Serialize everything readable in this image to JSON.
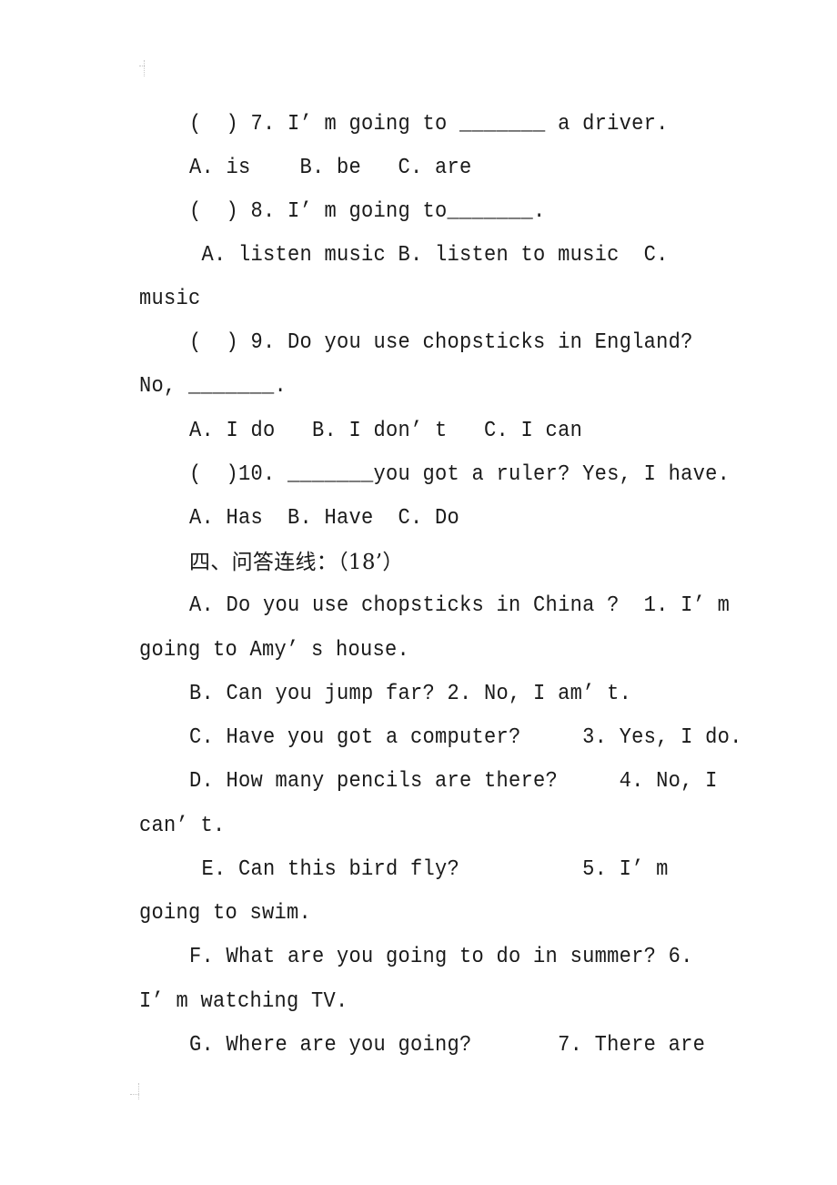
{
  "document": {
    "lines": [
      {
        "id": "q7",
        "text": "(  ) 7. I’ m going to _______ a driver."
      },
      {
        "id": "q7-options",
        "text": "A. is    B. be   C. are"
      },
      {
        "id": "q8",
        "text": "(  ) 8. I’ m going to_______."
      },
      {
        "id": "q8-options",
        "text": " A. listen music B. listen to music  C."
      },
      {
        "id": "q8-options-cont",
        "text": "music"
      },
      {
        "id": "q9",
        "text": "(  ) 9. Do you use chopsticks in England?"
      },
      {
        "id": "q9-cont",
        "text": "No, _______."
      },
      {
        "id": "q9-options",
        "text": "A. I do   B. I don’ t   C. I can"
      },
      {
        "id": "q10",
        "text": "(  )10. _______you got a ruler? Yes, I have."
      },
      {
        "id": "q10-options",
        "text": "A. Has  B. Have  C. Do"
      },
      {
        "id": "section-4-title",
        "text": "四、问答连线：（18’）"
      },
      {
        "id": "match-a",
        "text": "A. Do you use chopsticks in China ?  1. I’ m"
      },
      {
        "id": "match-a-cont",
        "text": "going to Amy’ s house."
      },
      {
        "id": "match-b",
        "text": "B. Can you jump far? 2. No, I am’ t."
      },
      {
        "id": "match-c",
        "text": "C. Have you got a computer?     3. Yes, I do."
      },
      {
        "id": "match-d",
        "text": "D. How many pencils are there?     4. No, I"
      },
      {
        "id": "match-d-cont",
        "text": "can’ t."
      },
      {
        "id": "match-e",
        "text": " E. Can this bird fly?          5. I’ m"
      },
      {
        "id": "match-e-cont",
        "text": "going to swim."
      },
      {
        "id": "match-f",
        "text": "F. What are you going to do in summer? 6."
      },
      {
        "id": "match-f-cont",
        "text": "I’ m watching TV."
      },
      {
        "id": "match-g",
        "text": "G. Where are you going?       7. There are"
      }
    ]
  }
}
